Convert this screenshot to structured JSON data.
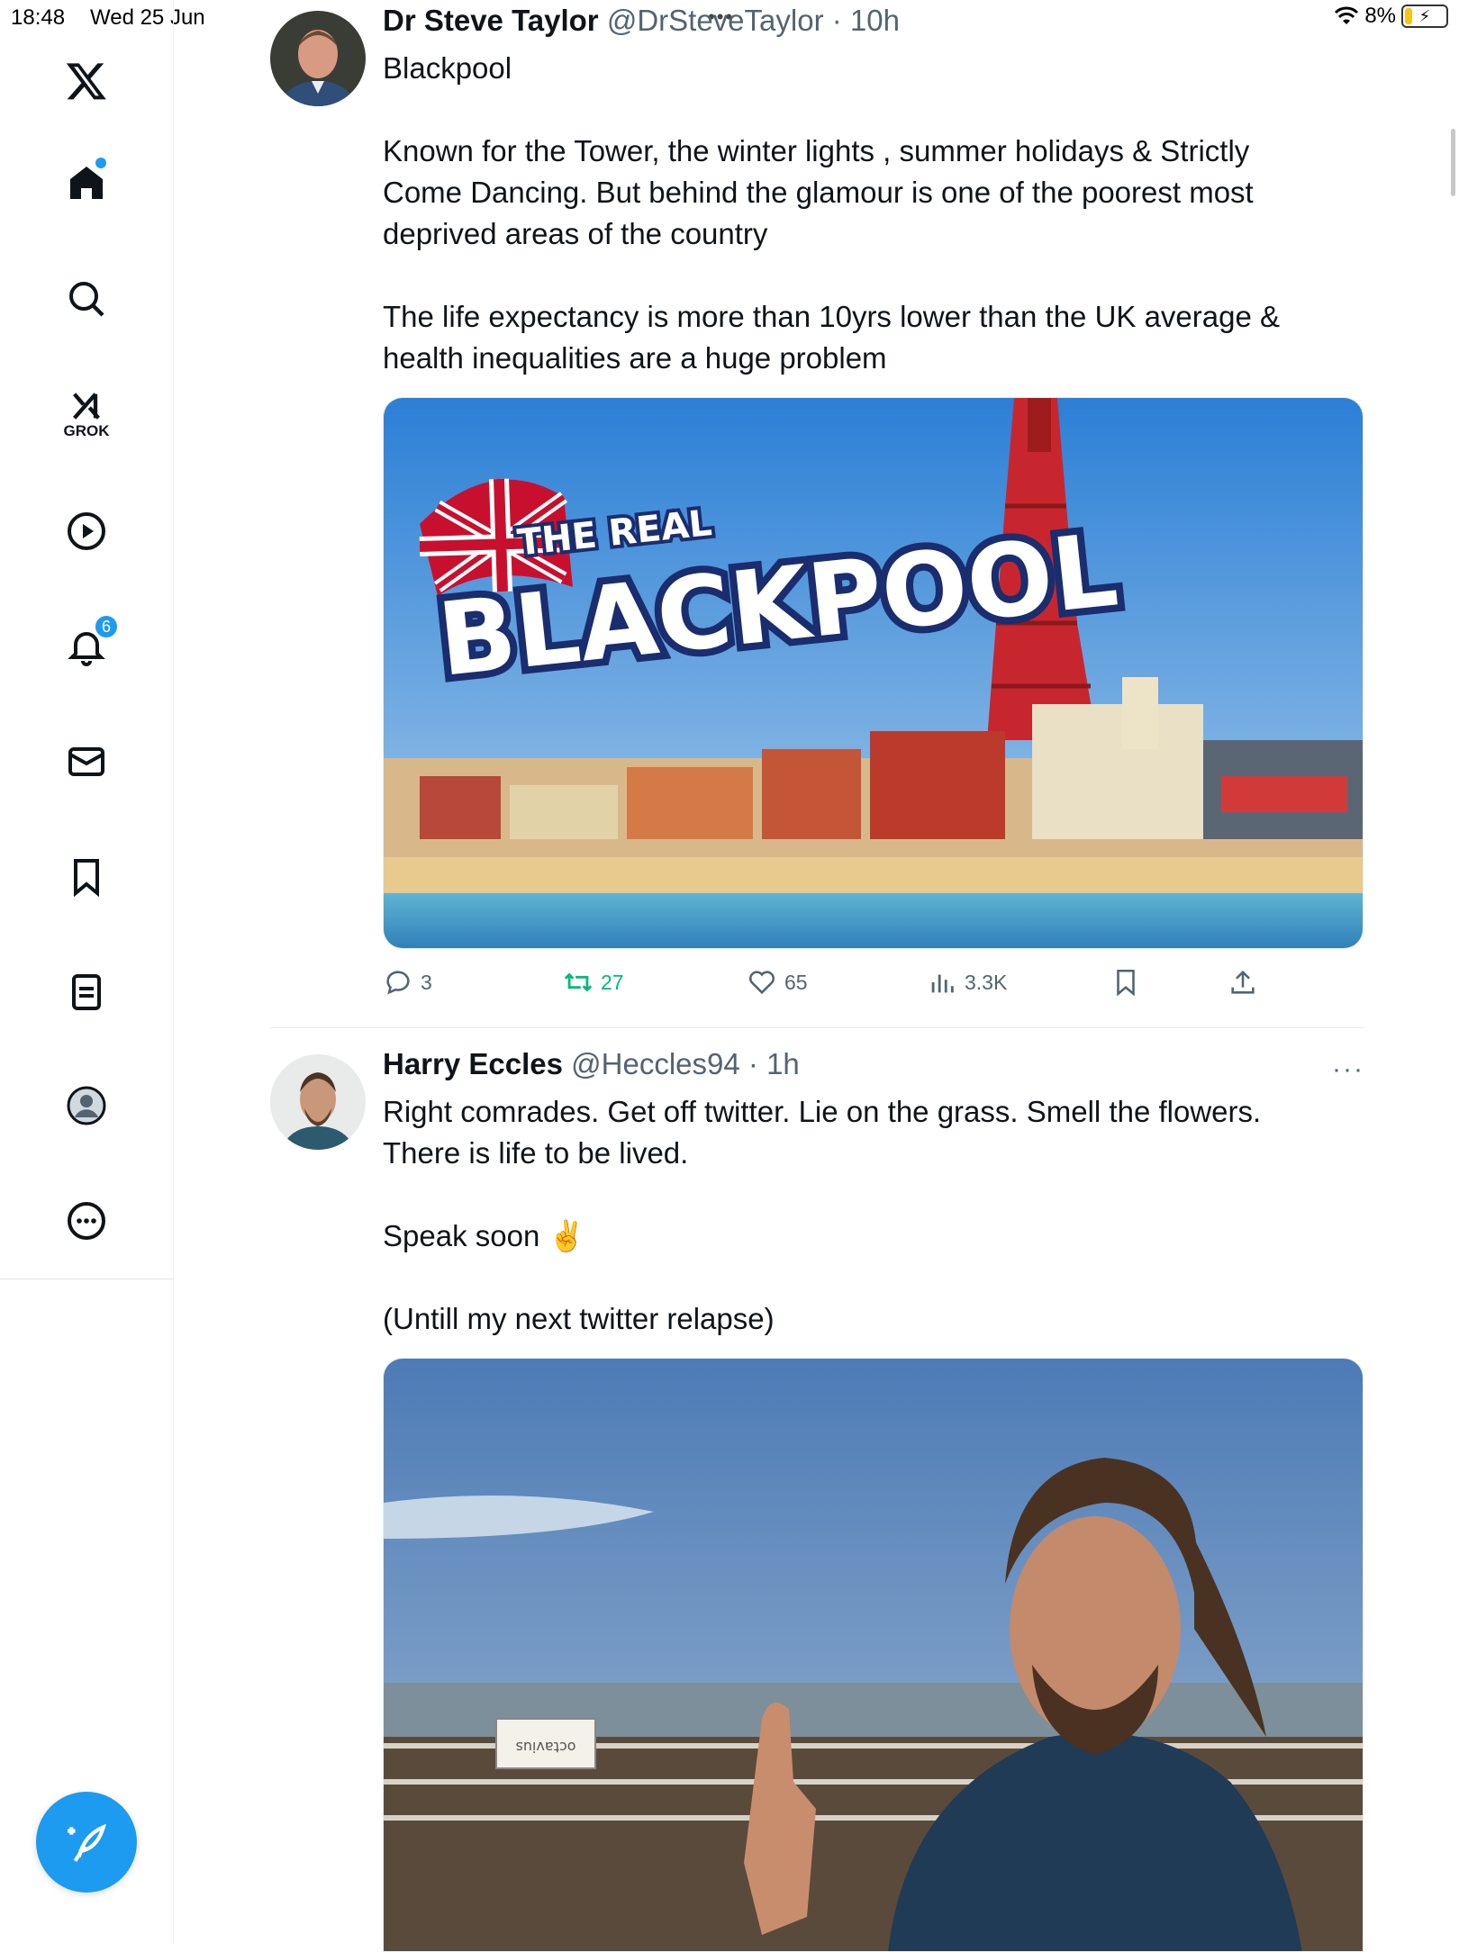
{
  "status_bar": {
    "time": "18:48",
    "date": "Wed 25 Jun",
    "battery": "8%",
    "battery_level": 0.08
  },
  "sidebar": {
    "logo": "x-logo-icon",
    "items": [
      {
        "icon": "home-icon",
        "has_dot": true
      },
      {
        "icon": "search-icon"
      },
      {
        "icon": "grok-icon",
        "label": "GROK"
      },
      {
        "icon": "play-icon"
      },
      {
        "icon": "bell-icon",
        "badge": "6"
      },
      {
        "icon": "mail-icon"
      },
      {
        "icon": "bookmark-icon"
      },
      {
        "icon": "list-icon"
      },
      {
        "icon": "profile-icon"
      },
      {
        "icon": "more-icon"
      }
    ],
    "compose_icon": "compose-icon"
  },
  "tweets": [
    {
      "name": "Dr Steve Taylor",
      "handle": "@DrSteveTaylor",
      "time": "· 10h",
      "text": [
        "Blackpool",
        "",
        "Known for the Tower, the winter lights , summer holidays & Strictly",
        "Come Dancing. But behind the glamour is one of the poorest most",
        "deprived areas of the country",
        "",
        "The life expectancy is more than 10yrs lower than the UK average &",
        "health inequalities are a huge problem"
      ],
      "media": {
        "overlay_top": "THE REAL",
        "overlay_main": "BLACKPOOL"
      },
      "stats": {
        "replies": "3",
        "retweets": "27",
        "likes": "65",
        "views": "3.3K"
      },
      "colors": {
        "retweet": "#00ba7c"
      }
    },
    {
      "name": "Harry Eccles",
      "handle": "@Heccles94",
      "time": "· 1h",
      "text": [
        "Right comrades. Get off twitter. Lie on the grass. Smell the flowers.",
        "There is life to be lived.",
        "",
        "Speak soon ✌️",
        "",
        "(Untill my next twitter relapse)"
      ],
      "media": {
        "sign_text": "octavius"
      },
      "more": "···"
    }
  ],
  "colors": {
    "accent": "#1d9bf0",
    "text": "#0f1419",
    "muted": "#536471"
  }
}
